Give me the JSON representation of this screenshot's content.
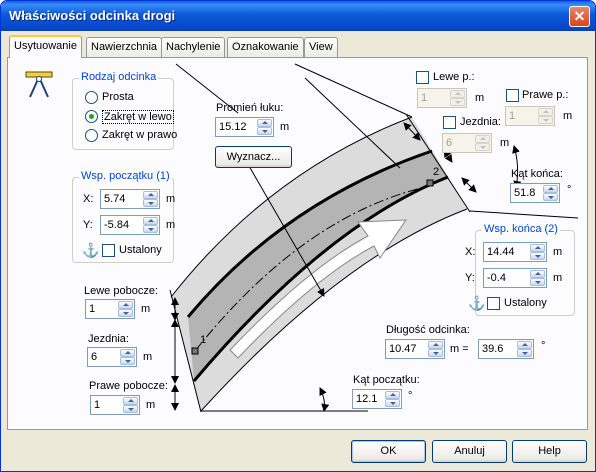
{
  "window": {
    "title": "Właściwości odcinka drogi",
    "close_glyph": "✕"
  },
  "tabs": [
    "Usytuowanie",
    "Nawierzchnia",
    "Nachylenie",
    "Oznakowanie",
    "View"
  ],
  "segment_type": {
    "title": "Rodzaj odcinka",
    "options": [
      "Prosta",
      "Zakręt w lewo",
      "Zakręt w prawo"
    ],
    "selected": "Zakręt w lewo"
  },
  "radius": {
    "label": "Promień łuku:",
    "value": "15.12",
    "unit": "m",
    "calc_button": "Wyznacz..."
  },
  "start_coords": {
    "title": "Wsp. początku (1)",
    "x_label": "X:",
    "x_value": "5.74",
    "y_label": "Y:",
    "y_value": "-5.84",
    "unit": "m",
    "fixed_label": "Ustalony"
  },
  "end_coords": {
    "title": "Wsp. końca (2)",
    "x_label": "X:",
    "x_value": "14.44",
    "y_label": "Y:",
    "y_value": "-0.4",
    "unit": "m",
    "fixed_label": "Ustalony"
  },
  "left_shoulder": {
    "label": "Lewe pobocze:",
    "value": "1",
    "unit": "m"
  },
  "lane": {
    "label": "Jezdnia:",
    "value": "6",
    "unit": "m"
  },
  "right_shoulder": {
    "label": "Prawe pobocze:",
    "value": "1",
    "unit": "m"
  },
  "end_left": {
    "label": "Lewe p.:",
    "value": "1",
    "unit": "m"
  },
  "end_right": {
    "label": "Prawe p.:",
    "value": "1",
    "unit": "m"
  },
  "end_lane": {
    "label": "Jezdnia:",
    "value": "6",
    "unit": "m"
  },
  "end_angle": {
    "label": "Kąt końca:",
    "value": "51.8",
    "unit": "°"
  },
  "length": {
    "label": "Długość odcinka:",
    "value1": "10.47",
    "eq_unit": "m =",
    "value2": "39.6",
    "unit2": "°"
  },
  "start_angle": {
    "label": "Kąt początku:",
    "value": "12.1",
    "unit": "°"
  },
  "point_labels": {
    "p1": "1",
    "p2": "2"
  },
  "buttons": {
    "ok": "OK",
    "cancel": "Anuluj",
    "help": "Help"
  },
  "icons": {
    "tool": "compass-ruler-icon",
    "anchor": "anchor-icon",
    "anchor_glyph": "⚓"
  }
}
